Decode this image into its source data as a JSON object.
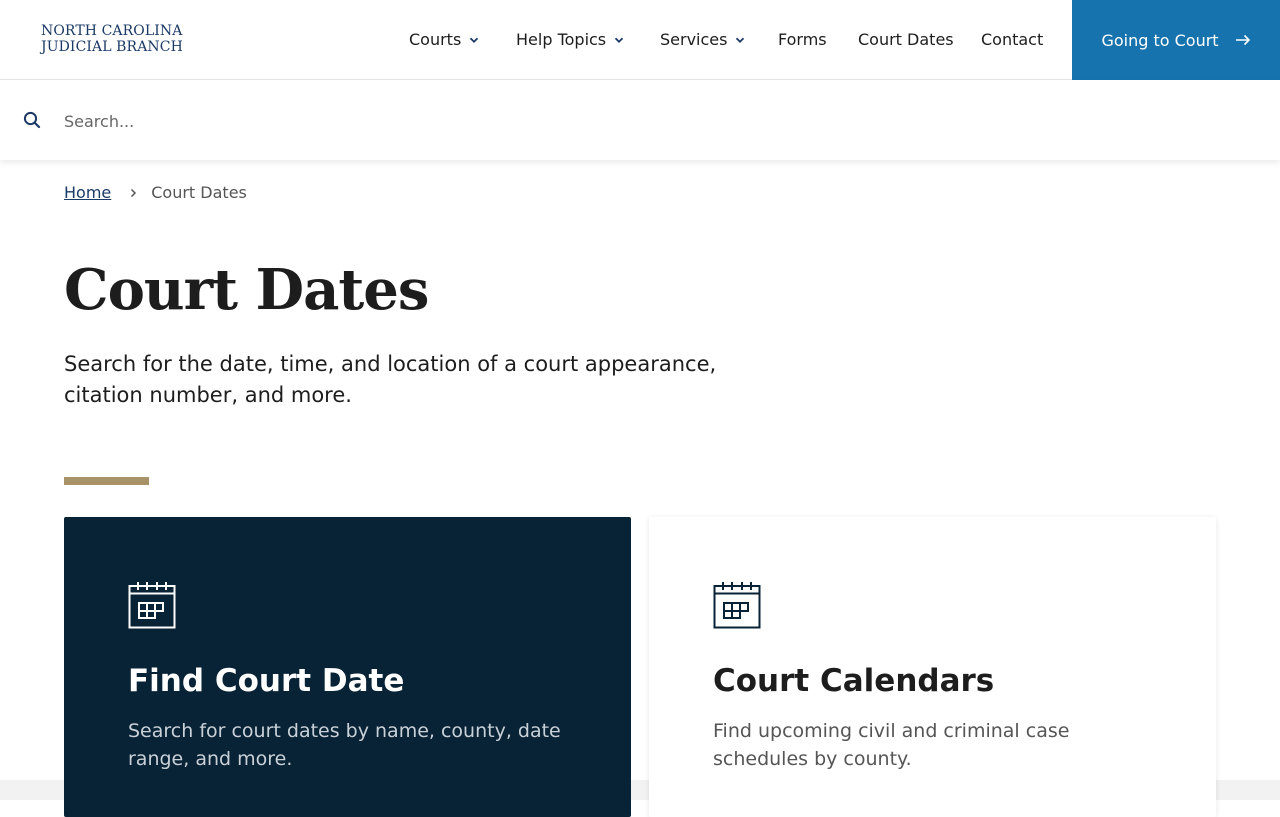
{
  "logo": {
    "line1": "NORTH CAROLINA",
    "line2": "JUDICIAL BRANCH"
  },
  "nav": {
    "items": [
      {
        "label": "Courts",
        "has_dropdown": true
      },
      {
        "label": "Help Topics",
        "has_dropdown": true
      },
      {
        "label": "Services",
        "has_dropdown": true
      },
      {
        "label": "Forms",
        "has_dropdown": false
      },
      {
        "label": "Court Dates",
        "has_dropdown": false
      },
      {
        "label": "Contact",
        "has_dropdown": false
      }
    ],
    "cta_label": "Going to Court"
  },
  "search": {
    "placeholder": "Search...",
    "value": ""
  },
  "breadcrumb": {
    "home": "Home",
    "current": "Court Dates"
  },
  "page": {
    "title": "Court Dates",
    "intro": "Search for the date, time, and location of a court appearance, citation number, and more."
  },
  "cards": [
    {
      "title": "Find Court Date",
      "description": "Search for court dates by name, county, date range, and more.",
      "icon": "calendar-icon"
    },
    {
      "title": "Court Calendars",
      "description": "Find upcoming civil and criminal case schedules by county.",
      "icon": "calendar-icon"
    }
  ],
  "colors": {
    "brand_navy": "#1b3a66",
    "cta_blue": "#1673ad",
    "card_dark": "#082236",
    "accent_gold": "#a89268"
  }
}
